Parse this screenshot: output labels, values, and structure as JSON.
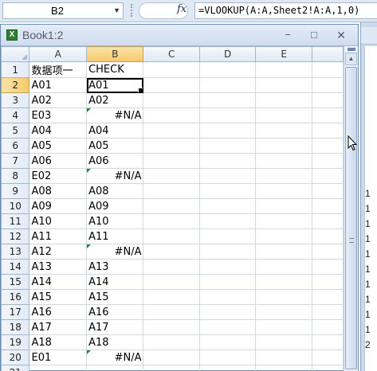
{
  "formula_bar": {
    "name_box": "B2",
    "fx_label": "fx",
    "formula": "=VLOOKUP(A:A,Sheet2!A:A,1,0)"
  },
  "workbook": {
    "title": "Book1:2",
    "minimize": "−",
    "restore": "□",
    "close": "✕"
  },
  "columns": [
    "A",
    "B",
    "C",
    "D",
    "E"
  ],
  "rows": [
    {
      "num": "1",
      "a": "数据项一",
      "b": "CHECK",
      "err": false
    },
    {
      "num": "2",
      "a": "A01",
      "b": "A01",
      "err": false
    },
    {
      "num": "3",
      "a": "A02",
      "b": "A02",
      "err": false
    },
    {
      "num": "4",
      "a": "E03",
      "b": "#N/A",
      "err": true
    },
    {
      "num": "5",
      "a": "A04",
      "b": "A04",
      "err": false
    },
    {
      "num": "6",
      "a": "A05",
      "b": "A05",
      "err": false
    },
    {
      "num": "7",
      "a": "A06",
      "b": "A06",
      "err": false
    },
    {
      "num": "8",
      "a": "E02",
      "b": "#N/A",
      "err": true
    },
    {
      "num": "9",
      "a": "A08",
      "b": "A08",
      "err": false
    },
    {
      "num": "10",
      "a": "A09",
      "b": "A09",
      "err": false
    },
    {
      "num": "11",
      "a": "A10",
      "b": "A10",
      "err": false
    },
    {
      "num": "12",
      "a": "A11",
      "b": "A11",
      "err": false
    },
    {
      "num": "13",
      "a": "A12",
      "b": "#N/A",
      "err": true
    },
    {
      "num": "14",
      "a": "A13",
      "b": "A13",
      "err": false
    },
    {
      "num": "15",
      "a": "A14",
      "b": "A14",
      "err": false
    },
    {
      "num": "16",
      "a": "A15",
      "b": "A15",
      "err": false
    },
    {
      "num": "17",
      "a": "A16",
      "b": "A16",
      "err": false
    },
    {
      "num": "18",
      "a": "A17",
      "b": "A17",
      "err": false
    },
    {
      "num": "19",
      "a": "A18",
      "b": "A18",
      "err": false
    },
    {
      "num": "20",
      "a": "E01",
      "b": "#N/A",
      "err": true
    },
    {
      "num": "21",
      "a": "",
      "b": "",
      "err": false
    }
  ],
  "selected_cell": {
    "row": "2",
    "col": "B"
  },
  "background_window": {
    "row_numbers": [
      "1",
      "1",
      "1",
      "1",
      "1",
      "1",
      "1",
      "1",
      "1",
      "1",
      "2"
    ]
  },
  "colors": {
    "error_indicator": "#1e8a2e",
    "selected_header": "#f7c969",
    "chrome": "#dfe8f5"
  }
}
